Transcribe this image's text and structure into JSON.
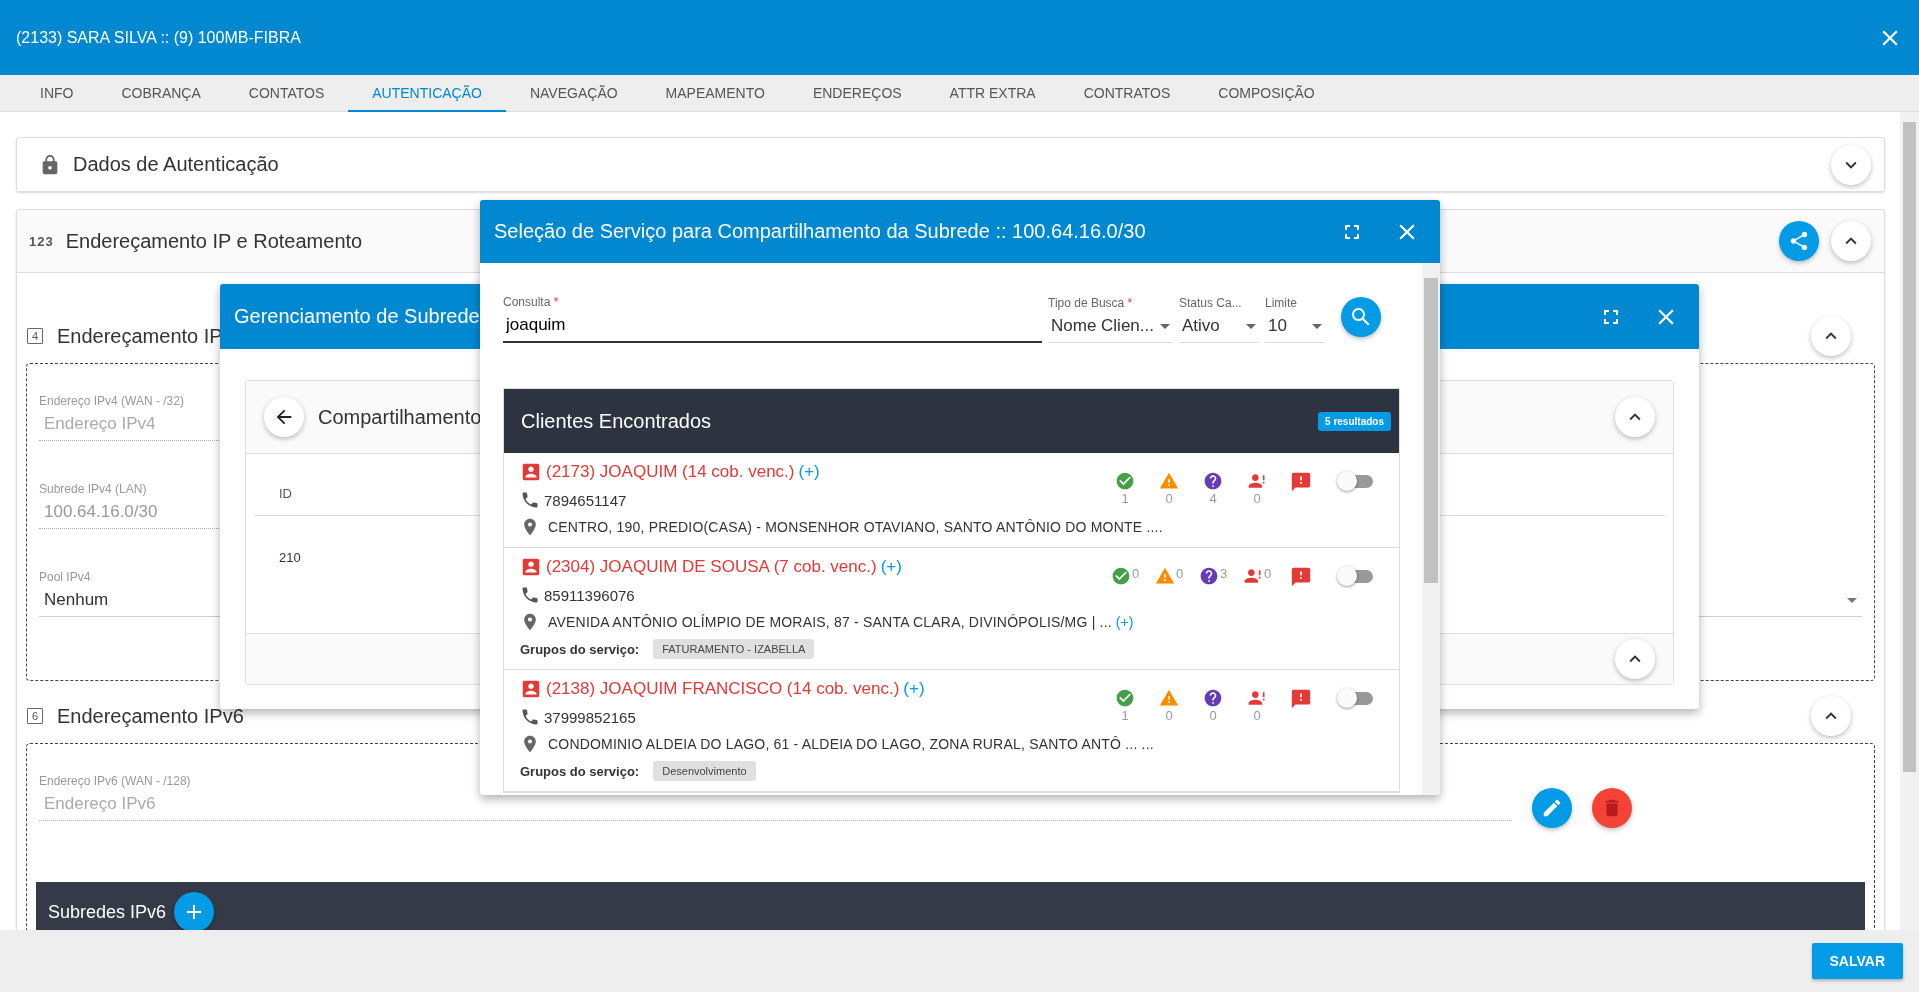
{
  "window": {
    "title": "(2133) SARA SILVA :: (9) 100MB-FIBRA"
  },
  "tabs": [
    {
      "label": "INFO",
      "selected": false
    },
    {
      "label": "COBRANÇA",
      "selected": false
    },
    {
      "label": "CONTATOS",
      "selected": false
    },
    {
      "label": "AUTENTICAÇÃO",
      "selected": true
    },
    {
      "label": "NAVEGAÇÃO",
      "selected": false
    },
    {
      "label": "MAPEAMENTO",
      "selected": false
    },
    {
      "label": "ENDEREÇOS",
      "selected": false
    },
    {
      "label": "ATTR EXTRA",
      "selected": false
    },
    {
      "label": "CONTRATOS",
      "selected": false
    },
    {
      "label": "COMPOSIÇÃO",
      "selected": false
    }
  ],
  "auth_card": {
    "title": "Dados de Autenticação"
  },
  "ip_card": {
    "icon_text": "123",
    "title": "Endereçamento IP e Roteamento",
    "ipv4": {
      "badge": "4",
      "title": "Endereçamento IP",
      "fields": [
        {
          "kind": "input",
          "label": "Endereço IPv4 (WAN - /32)",
          "placeholder": "Endereço IPv4"
        },
        {
          "kind": "readonly",
          "label": "Subrede IPv4 (LAN)",
          "value": "100.64.16.0/30"
        },
        {
          "kind": "select",
          "label": "Pool IPv4",
          "value": "Nenhum"
        }
      ]
    },
    "ipv6": {
      "badge": "6",
      "title": "Endereçamento IPv6",
      "field": {
        "label": "Endereço IPv6 (WAN - /128)",
        "placeholder": "Endereço IPv6"
      },
      "subnets_title": "Subredes IPv6"
    }
  },
  "subnet_dialog": {
    "title": "Gerenciamento de Subrede",
    "card_title": "Compartilhamento",
    "column": "ID",
    "row": "210"
  },
  "service_dialog": {
    "title": "Seleção de Serviço para Compartilhamento da Subrede :: 100.64.16.0/30",
    "query": {
      "label": "Consulta",
      "mark": "*",
      "value": "joaquim"
    },
    "filters": [
      {
        "label": "Tipo de Busca",
        "mark": "*",
        "value": "Nome Clien..."
      },
      {
        "label": "Status Ca...",
        "value": "Ativo"
      },
      {
        "label": "Limite",
        "value": "10"
      }
    ],
    "results_title": "Clientes Encontrados",
    "results_badge": "5 resultados",
    "clients": [
      {
        "name": "(2173) JOAQUIM (14 cob. venc.)",
        "more": "(+)",
        "phone": "7894651147",
        "address": "CENTRO, 190, PREDIO(CASA) - MONSENHOR OTAVIANO, SANTO ANTÔNIO DO MONTE ....",
        "counts": [
          "1",
          "0",
          "4",
          "0"
        ],
        "counts_inline": false,
        "enabled": false
      },
      {
        "name": "(2304) JOAQUIM DE SOUSA (7 cob. venc.)",
        "more": "(+)",
        "phone": "85911396076",
        "address": "AVENIDA ANTÔNIO OLÍMPIO DE MORAIS, 87 - SANTA CLARA, DIVINÓPOLIS/MG | ...",
        "address_more": "(+)",
        "groups_label": "Grupos do serviço:",
        "groups": [
          "FATURAMENTO - IZABELLA"
        ],
        "counts": [
          "0",
          "0",
          "3",
          "0"
        ],
        "counts_inline": true,
        "enabled": false
      },
      {
        "name": "(2138) JOAQUIM FRANCISCO (14 cob. venc.)",
        "more": "(+)",
        "phone": "37999852165",
        "address": "CONDOMINIO ALDEIA DO LAGO, 61 - ALDEIA DO LAGO, ZONA RURAL, SANTO ANTÔ ... ...",
        "groups_label": "Grupos do serviço:",
        "groups": [
          "Desenvolvimento"
        ],
        "counts": [
          "1",
          "0",
          "0",
          "0"
        ],
        "counts_inline": false,
        "enabled": false
      }
    ]
  },
  "footer": {
    "save": "SALVAR"
  }
}
